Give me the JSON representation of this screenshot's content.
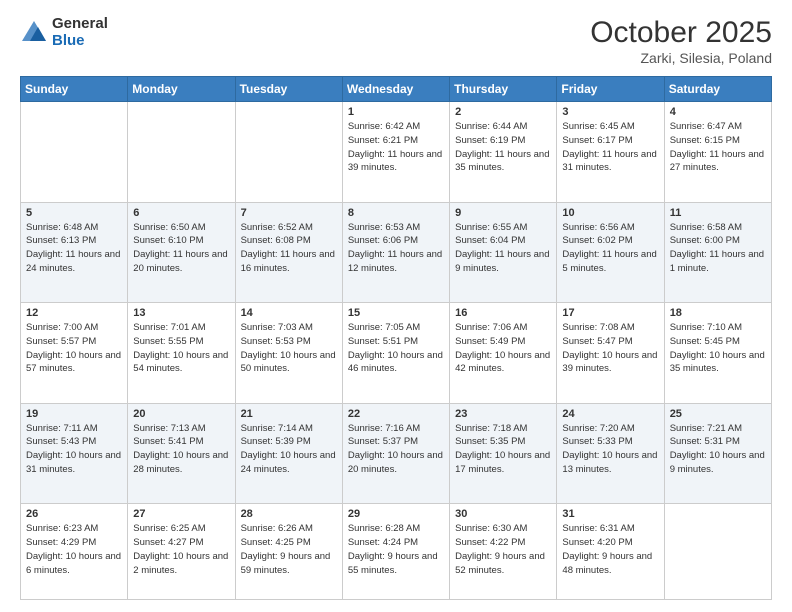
{
  "header": {
    "logo": {
      "general": "General",
      "blue": "Blue"
    },
    "title": "October 2025",
    "location": "Zarki, Silesia, Poland"
  },
  "weekdays": [
    "Sunday",
    "Monday",
    "Tuesday",
    "Wednesday",
    "Thursday",
    "Friday",
    "Saturday"
  ],
  "weeks": [
    {
      "days": [
        {
          "num": "",
          "info": ""
        },
        {
          "num": "",
          "info": ""
        },
        {
          "num": "",
          "info": ""
        },
        {
          "num": "1",
          "sunrise": "Sunrise: 6:42 AM",
          "sunset": "Sunset: 6:21 PM",
          "daylight": "Daylight: 11 hours and 39 minutes."
        },
        {
          "num": "2",
          "sunrise": "Sunrise: 6:44 AM",
          "sunset": "Sunset: 6:19 PM",
          "daylight": "Daylight: 11 hours and 35 minutes."
        },
        {
          "num": "3",
          "sunrise": "Sunrise: 6:45 AM",
          "sunset": "Sunset: 6:17 PM",
          "daylight": "Daylight: 11 hours and 31 minutes."
        },
        {
          "num": "4",
          "sunrise": "Sunrise: 6:47 AM",
          "sunset": "Sunset: 6:15 PM",
          "daylight": "Daylight: 11 hours and 27 minutes."
        }
      ]
    },
    {
      "days": [
        {
          "num": "5",
          "sunrise": "Sunrise: 6:48 AM",
          "sunset": "Sunset: 6:13 PM",
          "daylight": "Daylight: 11 hours and 24 minutes."
        },
        {
          "num": "6",
          "sunrise": "Sunrise: 6:50 AM",
          "sunset": "Sunset: 6:10 PM",
          "daylight": "Daylight: 11 hours and 20 minutes."
        },
        {
          "num": "7",
          "sunrise": "Sunrise: 6:52 AM",
          "sunset": "Sunset: 6:08 PM",
          "daylight": "Daylight: 11 hours and 16 minutes."
        },
        {
          "num": "8",
          "sunrise": "Sunrise: 6:53 AM",
          "sunset": "Sunset: 6:06 PM",
          "daylight": "Daylight: 11 hours and 12 minutes."
        },
        {
          "num": "9",
          "sunrise": "Sunrise: 6:55 AM",
          "sunset": "Sunset: 6:04 PM",
          "daylight": "Daylight: 11 hours and 9 minutes."
        },
        {
          "num": "10",
          "sunrise": "Sunrise: 6:56 AM",
          "sunset": "Sunset: 6:02 PM",
          "daylight": "Daylight: 11 hours and 5 minutes."
        },
        {
          "num": "11",
          "sunrise": "Sunrise: 6:58 AM",
          "sunset": "Sunset: 6:00 PM",
          "daylight": "Daylight: 11 hours and 1 minute."
        }
      ]
    },
    {
      "days": [
        {
          "num": "12",
          "sunrise": "Sunrise: 7:00 AM",
          "sunset": "Sunset: 5:57 PM",
          "daylight": "Daylight: 10 hours and 57 minutes."
        },
        {
          "num": "13",
          "sunrise": "Sunrise: 7:01 AM",
          "sunset": "Sunset: 5:55 PM",
          "daylight": "Daylight: 10 hours and 54 minutes."
        },
        {
          "num": "14",
          "sunrise": "Sunrise: 7:03 AM",
          "sunset": "Sunset: 5:53 PM",
          "daylight": "Daylight: 10 hours and 50 minutes."
        },
        {
          "num": "15",
          "sunrise": "Sunrise: 7:05 AM",
          "sunset": "Sunset: 5:51 PM",
          "daylight": "Daylight: 10 hours and 46 minutes."
        },
        {
          "num": "16",
          "sunrise": "Sunrise: 7:06 AM",
          "sunset": "Sunset: 5:49 PM",
          "daylight": "Daylight: 10 hours and 42 minutes."
        },
        {
          "num": "17",
          "sunrise": "Sunrise: 7:08 AM",
          "sunset": "Sunset: 5:47 PM",
          "daylight": "Daylight: 10 hours and 39 minutes."
        },
        {
          "num": "18",
          "sunrise": "Sunrise: 7:10 AM",
          "sunset": "Sunset: 5:45 PM",
          "daylight": "Daylight: 10 hours and 35 minutes."
        }
      ]
    },
    {
      "days": [
        {
          "num": "19",
          "sunrise": "Sunrise: 7:11 AM",
          "sunset": "Sunset: 5:43 PM",
          "daylight": "Daylight: 10 hours and 31 minutes."
        },
        {
          "num": "20",
          "sunrise": "Sunrise: 7:13 AM",
          "sunset": "Sunset: 5:41 PM",
          "daylight": "Daylight: 10 hours and 28 minutes."
        },
        {
          "num": "21",
          "sunrise": "Sunrise: 7:14 AM",
          "sunset": "Sunset: 5:39 PM",
          "daylight": "Daylight: 10 hours and 24 minutes."
        },
        {
          "num": "22",
          "sunrise": "Sunrise: 7:16 AM",
          "sunset": "Sunset: 5:37 PM",
          "daylight": "Daylight: 10 hours and 20 minutes."
        },
        {
          "num": "23",
          "sunrise": "Sunrise: 7:18 AM",
          "sunset": "Sunset: 5:35 PM",
          "daylight": "Daylight: 10 hours and 17 minutes."
        },
        {
          "num": "24",
          "sunrise": "Sunrise: 7:20 AM",
          "sunset": "Sunset: 5:33 PM",
          "daylight": "Daylight: 10 hours and 13 minutes."
        },
        {
          "num": "25",
          "sunrise": "Sunrise: 7:21 AM",
          "sunset": "Sunset: 5:31 PM",
          "daylight": "Daylight: 10 hours and 9 minutes."
        }
      ]
    },
    {
      "days": [
        {
          "num": "26",
          "sunrise": "Sunrise: 6:23 AM",
          "sunset": "Sunset: 4:29 PM",
          "daylight": "Daylight: 10 hours and 6 minutes."
        },
        {
          "num": "27",
          "sunrise": "Sunrise: 6:25 AM",
          "sunset": "Sunset: 4:27 PM",
          "daylight": "Daylight: 10 hours and 2 minutes."
        },
        {
          "num": "28",
          "sunrise": "Sunrise: 6:26 AM",
          "sunset": "Sunset: 4:25 PM",
          "daylight": "Daylight: 9 hours and 59 minutes."
        },
        {
          "num": "29",
          "sunrise": "Sunrise: 6:28 AM",
          "sunset": "Sunset: 4:24 PM",
          "daylight": "Daylight: 9 hours and 55 minutes."
        },
        {
          "num": "30",
          "sunrise": "Sunrise: 6:30 AM",
          "sunset": "Sunset: 4:22 PM",
          "daylight": "Daylight: 9 hours and 52 minutes."
        },
        {
          "num": "31",
          "sunrise": "Sunrise: 6:31 AM",
          "sunset": "Sunset: 4:20 PM",
          "daylight": "Daylight: 9 hours and 48 minutes."
        },
        {
          "num": "",
          "info": ""
        }
      ]
    }
  ]
}
